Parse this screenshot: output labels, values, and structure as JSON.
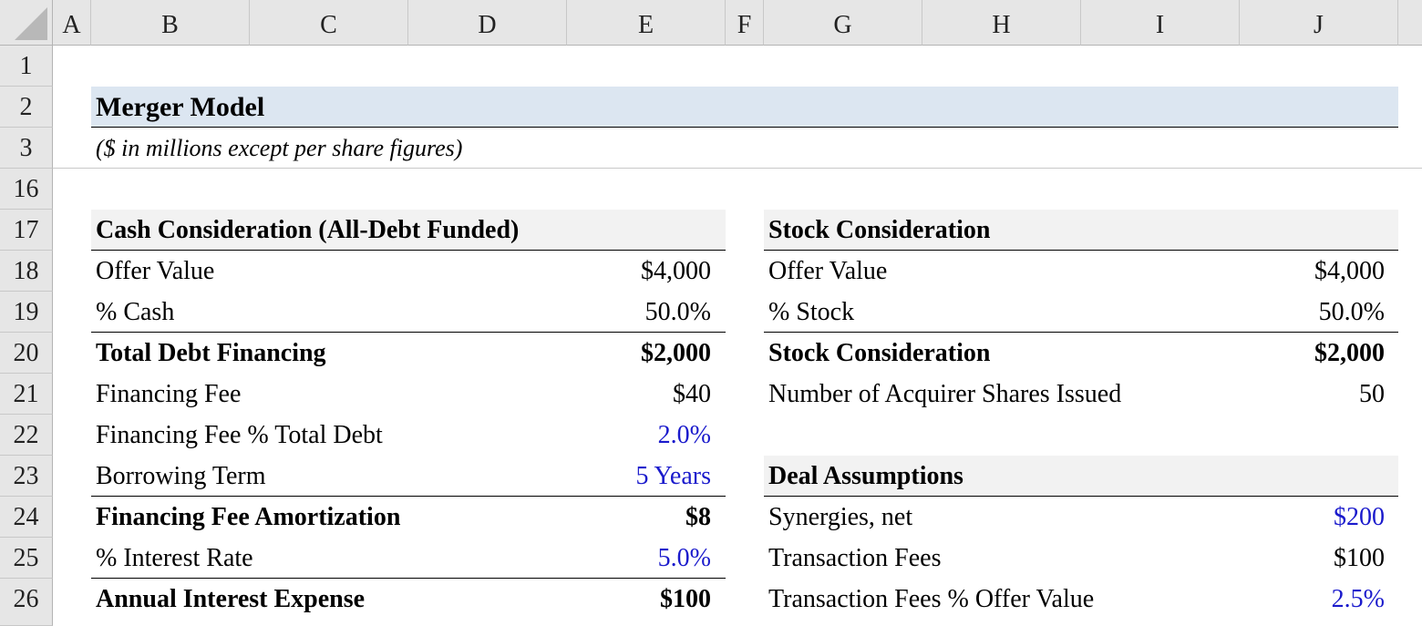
{
  "columns": [
    "A",
    "B",
    "C",
    "D",
    "E",
    "F",
    "G",
    "H",
    "I",
    "J"
  ],
  "rows": [
    "1",
    "2",
    "3",
    "16",
    "17",
    "18",
    "19",
    "20",
    "21",
    "22",
    "23",
    "24",
    "25",
    "26"
  ],
  "title": "Merger Model",
  "subtitle": "($ in millions except per share figures)",
  "cash": {
    "header": "Cash Consideration (All-Debt Funded)",
    "rows": [
      {
        "label": "Offer Value",
        "value": "$4,000"
      },
      {
        "label": "% Cash",
        "value": "50.0%"
      },
      {
        "label": "Total Debt Financing",
        "value": "$2,000"
      },
      {
        "label": "Financing Fee",
        "value": "$40"
      },
      {
        "label": "Financing Fee % Total Debt",
        "value": "2.0%"
      },
      {
        "label": "Borrowing Term",
        "value": "5 Years"
      },
      {
        "label": "Financing Fee Amortization",
        "value": "$8"
      },
      {
        "label": "% Interest Rate",
        "value": "5.0%"
      },
      {
        "label": "Annual Interest Expense",
        "value": "$100"
      }
    ]
  },
  "stock": {
    "header": "Stock Consideration",
    "rows": [
      {
        "label": "Offer Value",
        "value": "$4,000"
      },
      {
        "label": "% Stock",
        "value": "50.0%"
      },
      {
        "label": "Stock Consideration",
        "value": "$2,000"
      },
      {
        "label": "Number of Acquirer Shares Issued",
        "value": "50"
      }
    ]
  },
  "deal": {
    "header": "Deal Assumptions",
    "rows": [
      {
        "label": "Synergies, net",
        "value": "$200"
      },
      {
        "label": "Transaction Fees",
        "value": "$100"
      },
      {
        "label": "Transaction Fees % Offer Value",
        "value": "2.5%"
      }
    ]
  },
  "colors": {
    "input_blue": "#1a1acc",
    "title_fill": "#dce6f1",
    "header_fill": "#f2f2f2",
    "grid_header": "#e6e6e6"
  }
}
